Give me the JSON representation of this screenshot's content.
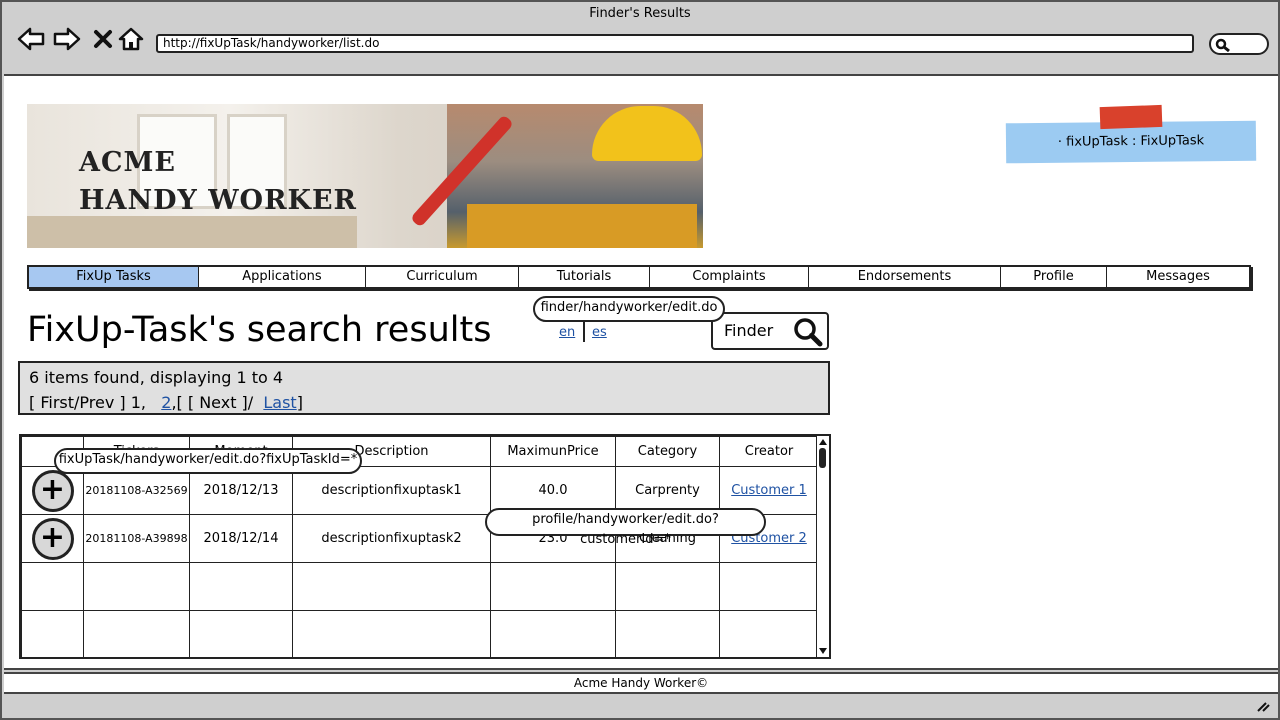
{
  "window": {
    "title": "Finder's Results"
  },
  "browser": {
    "url": "http://fixUpTask/handyworker/list.do"
  },
  "banner": {
    "logo_line1": "ACME",
    "logo_line2": "HANDY WORKER"
  },
  "user": {
    "label": "· fixUpTask : FixUpTask"
  },
  "menu": {
    "items": [
      {
        "label": "FixUp Tasks",
        "active": true
      },
      {
        "label": "Applications"
      },
      {
        "label": "Curriculum"
      },
      {
        "label": "Tutorials"
      },
      {
        "label": "Complaints"
      },
      {
        "label": "Endorsements"
      },
      {
        "label": "Profile"
      },
      {
        "label": "Messages"
      }
    ]
  },
  "page": {
    "title": "FixUp-Task's search results",
    "lang_en": "en",
    "lang_es": "es",
    "finder_label": "Finder",
    "finder_callout": "finder/handyworker/edit.do"
  },
  "pager": {
    "summary": "6 items found, displaying 1 to 4",
    "first_prev": "[ First/Prev ] 1,",
    "page2": "2",
    "bracket": ",[",
    "next": "[ Next ]/",
    "last": "Last",
    "close": "]"
  },
  "table": {
    "columns": [
      "",
      "Tickers",
      "Moment",
      "Description",
      "MaximunPrice",
      "Category",
      "Creator"
    ],
    "rows": [
      {
        "ticker": "20181108-A32569",
        "moment": "2018/12/13",
        "description": "descriptionfixuptask1",
        "max_price": "40.0",
        "category": "Carprenty",
        "creator": "Customer 1"
      },
      {
        "ticker": "20181108-A39898",
        "moment": "2018/12/14",
        "description": "descriptionfixuptask2",
        "max_price": "23.0",
        "category": "Cleaning",
        "creator": "Customer 2"
      }
    ],
    "edit_callout": "fixUpTask/handyworker/edit.do?fixUpTaskId=*",
    "profile_callout": "profile/handyworker/edit.do?customerId=*"
  },
  "footer": {
    "text": "Acme Handy Worker©"
  }
}
